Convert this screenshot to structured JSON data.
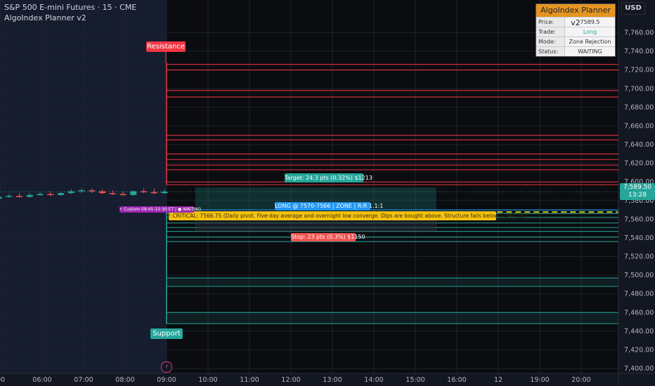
{
  "header": {
    "symbol_line": "S&P 500 E-mini Futures · 15 · CME",
    "indicator_line": "AlgoIndex Planner v2",
    "currency_button": "USD"
  },
  "panel": {
    "title": "AlgoIndex Planner v2",
    "rows": [
      {
        "label": "Price:",
        "value": "7589.5"
      },
      {
        "label": "Trade:",
        "value": "Long"
      },
      {
        "label": "Mode:",
        "value": "Zone Rejection"
      },
      {
        "label": "Status:",
        "value": "WAITING"
      }
    ]
  },
  "labels": {
    "resistance": "Resistance",
    "support": "Support",
    "target": "Target: 24.3 pts (0.32%) $1213",
    "entry": "LONG @ 7570-7566 | ZONE | R:R 1.1:1",
    "stop": "Stop: 23 pts (0.3%) $1150",
    "critical": "! CRITICAL: 7566.75 (Daily pivot. Five-day average and overnight low converge. Dips are bought above. Structure fails below 7,547.25.)",
    "session": "⚡ Custom 09:45-15:30 ET | ● WAITING",
    "bolt": "⚡"
  },
  "price_tag": {
    "price": "7,589.50",
    "countdown": "13:28"
  },
  "colors": {
    "background": "#131722",
    "resistance": "#f23645",
    "support": "#26a69a",
    "target": "#26a69a",
    "entry": "#2196f3",
    "stop": "#ef5350",
    "critical": "#f5c211",
    "session": "#9c27b0",
    "up_candle": "#26a69a",
    "down_candle": "#ef5350",
    "panel_title": "#e69520"
  },
  "chart_data": {
    "type": "candlestick",
    "ylim": [
      7400,
      7780
    ],
    "y_ticks": [
      7400,
      7420,
      7440,
      7460,
      7480,
      7500,
      7520,
      7540,
      7560,
      7580,
      7600,
      7620,
      7640,
      7660,
      7680,
      7700,
      7720,
      7740,
      7760
    ],
    "y_tick_labels": [
      "7,400.00",
      "7,420.00",
      "7,440.00",
      "7,460.00",
      "7,480.00",
      "7,500.00",
      "7,520.00",
      "7,540.00",
      "7,560.00",
      "7,580.00",
      "7,600.00",
      "7,620.00",
      "7,640.00",
      "7,660.00",
      "7,680.00",
      "7,700.00",
      "7,720.00",
      "7,740.00",
      "7,760.00"
    ],
    "x_ticks": [
      {
        "label": "00",
        "hour": 5
      },
      {
        "label": "06:00",
        "hour": 6
      },
      {
        "label": "07:00",
        "hour": 7
      },
      {
        "label": "08:00",
        "hour": 8
      },
      {
        "label": "09:00",
        "hour": 9
      },
      {
        "label": "10:00",
        "hour": 10
      },
      {
        "label": "11:00",
        "hour": 11
      },
      {
        "label": "12:00",
        "hour": 12
      },
      {
        "label": "13:00",
        "hour": 13
      },
      {
        "label": "14:00",
        "hour": 14
      },
      {
        "label": "15:00",
        "hour": 15
      },
      {
        "label": "16:00",
        "hour": 16
      },
      {
        "label": "12",
        "hour": 17
      },
      {
        "label": "19:00",
        "hour": 18
      },
      {
        "label": "20:00",
        "hour": 19
      }
    ],
    "candles": [
      {
        "t": 4.95,
        "o": 7582,
        "h": 7585,
        "l": 7580,
        "c": 7584
      },
      {
        "t": 5.2,
        "o": 7584,
        "h": 7587,
        "l": 7583,
        "c": 7585
      },
      {
        "t": 5.45,
        "o": 7585,
        "h": 7588,
        "l": 7583,
        "c": 7584
      },
      {
        "t": 5.7,
        "o": 7584,
        "h": 7588,
        "l": 7583,
        "c": 7586
      },
      {
        "t": 5.95,
        "o": 7586,
        "h": 7589,
        "l": 7585,
        "c": 7587
      },
      {
        "t": 6.2,
        "o": 7587,
        "h": 7590,
        "l": 7585,
        "c": 7586
      },
      {
        "t": 6.45,
        "o": 7586,
        "h": 7589,
        "l": 7585,
        "c": 7588
      },
      {
        "t": 6.7,
        "o": 7588,
        "h": 7592,
        "l": 7587,
        "c": 7590
      },
      {
        "t": 6.95,
        "o": 7590,
        "h": 7593,
        "l": 7588,
        "c": 7591
      },
      {
        "t": 7.2,
        "o": 7591,
        "h": 7593,
        "l": 7588,
        "c": 7590
      },
      {
        "t": 7.45,
        "o": 7590,
        "h": 7592,
        "l": 7587,
        "c": 7588
      },
      {
        "t": 7.7,
        "o": 7588,
        "h": 7591,
        "l": 7586,
        "c": 7587
      },
      {
        "t": 7.95,
        "o": 7587,
        "h": 7590,
        "l": 7585,
        "c": 7586
      },
      {
        "t": 8.2,
        "o": 7586,
        "h": 7591,
        "l": 7585,
        "c": 7590
      },
      {
        "t": 8.45,
        "o": 7590,
        "h": 7593,
        "l": 7588,
        "c": 7589
      },
      {
        "t": 8.7,
        "o": 7589,
        "h": 7593,
        "l": 7587,
        "c": 7588
      },
      {
        "t": 8.95,
        "o": 7588,
        "h": 7592,
        "l": 7587,
        "c": 7589.5
      }
    ],
    "resistance_zone": {
      "start_hour": 9,
      "top": 7728,
      "bottom": 7597
    },
    "resistance_lines": [
      7726,
      7720,
      7698,
      7691,
      7650,
      7645,
      7630,
      7624,
      7618,
      7613,
      7600,
      7597
    ],
    "support_zone": {
      "start_hour": 9,
      "top": 7570,
      "bottom": 7448
    },
    "support_lines": [
      7570,
      7566,
      7562,
      7556,
      7551,
      7547,
      7541,
      7536,
      7497,
      7488,
      7460,
      7448
    ],
    "trade_box": {
      "start_hour": 9.7,
      "end_hour": 15.5,
      "target": 7593.8,
      "entry_high": 7570,
      "entry_low": 7566,
      "stop": 7547
    },
    "critical_level": 7566.75,
    "current_price": 7589.5
  }
}
